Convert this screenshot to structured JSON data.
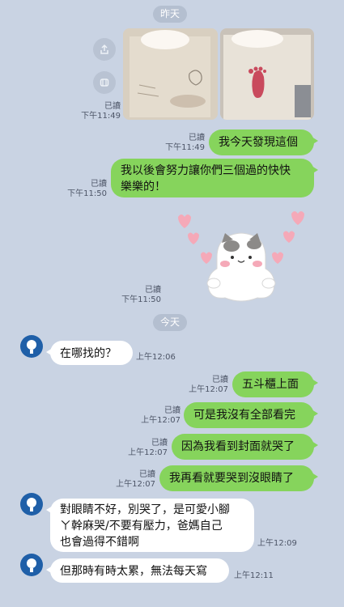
{
  "date_pills": {
    "yesterday": "昨天",
    "today": "今天"
  },
  "photos": {
    "read": "已讀",
    "time": "下午11:49"
  },
  "messages": [
    {
      "side": "out",
      "text": "我今天發現這個",
      "read": "已讀",
      "time": "下午11:49"
    },
    {
      "side": "out",
      "text_line1": "我以後會努力讓你們三個過的快快",
      "text_line2": "樂樂的！",
      "read": "已讀",
      "time": "下午11:50"
    },
    {
      "side": "out",
      "kind": "sticker",
      "read": "已讀",
      "time": "下午11:50"
    },
    {
      "side": "in",
      "text": "在哪找的？",
      "time": "上午12:06"
    },
    {
      "side": "out",
      "text": "五斗櫃上面",
      "read": "已讀",
      "time": "上午12:07"
    },
    {
      "side": "out",
      "text": "可是我沒有全部看完",
      "read": "已讀",
      "time": "上午12:07"
    },
    {
      "side": "out",
      "text": "因為我看到封面就哭了",
      "read": "已讀",
      "time": "上午12:07"
    },
    {
      "side": "out",
      "text": "我再看就要哭到沒眼睛了",
      "read": "已讀",
      "time": "上午12:07"
    },
    {
      "side": "in",
      "text_line1": "對眼睛不好，別哭了，是可愛小腳",
      "text_line2": "ㄚ幹麻哭/不要有壓力，爸媽自己",
      "text_line3": "也會過得不錯啊",
      "time": "上午12:09"
    },
    {
      "side": "in",
      "text": "但那時有時太累，無法每天寫",
      "time": "上午12:11"
    }
  ],
  "icons": {
    "share": "share-icon",
    "save": "save-icon",
    "avatar": "avatar-icon"
  },
  "colors": {
    "background": "#c9d3e3",
    "outgoing": "#86d45c",
    "incoming": "#ffffff",
    "avatar": "#1f5fa8"
  }
}
